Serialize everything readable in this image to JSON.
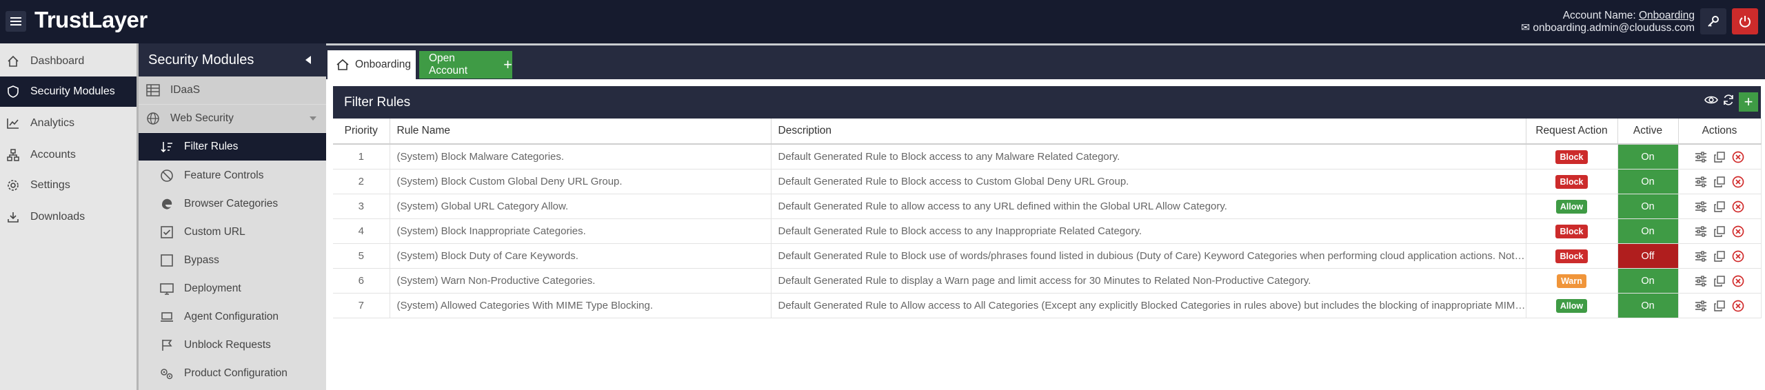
{
  "app": {
    "logo": "TrustLayer",
    "account_label": "Account Name:",
    "account_name": "Onboarding",
    "account_email": "onboarding.admin@clouduss.com"
  },
  "nav": {
    "items": [
      {
        "label": "Dashboard",
        "icon": "home-icon",
        "active": false
      },
      {
        "label": "Security Modules",
        "icon": "shield-icon",
        "active": true
      },
      {
        "label": "Analytics",
        "icon": "chart-icon",
        "active": false
      },
      {
        "label": "Accounts",
        "icon": "org-icon",
        "active": false
      },
      {
        "label": "Settings",
        "icon": "gear-icon",
        "active": false
      },
      {
        "label": "Downloads",
        "icon": "download-icon",
        "active": false
      }
    ]
  },
  "subnav": {
    "title": "Security Modules",
    "items": [
      {
        "label": "IDaaS",
        "icon": "table-icon"
      },
      {
        "label": "Web Security",
        "icon": "globe-icon"
      },
      {
        "label": "Filter Rules",
        "icon": "sort-icon"
      },
      {
        "label": "Feature Controls",
        "icon": "ban-icon"
      },
      {
        "label": "Browser Categories",
        "icon": "edge-icon"
      },
      {
        "label": "Custom URL",
        "icon": "checkbox-icon"
      },
      {
        "label": "Bypass",
        "icon": "square-icon"
      },
      {
        "label": "Deployment",
        "icon": "monitor-icon"
      },
      {
        "label": "Agent Configuration",
        "icon": "laptop-icon"
      },
      {
        "label": "Unblock Requests",
        "icon": "flag-icon"
      },
      {
        "label": "Product Configuration",
        "icon": "gears-icon"
      }
    ]
  },
  "tabs": {
    "onboarding": "Onboarding",
    "open_account": "Open Account"
  },
  "panel": {
    "title": "Filter Rules"
  },
  "table": {
    "headers": {
      "priority": "Priority",
      "rule_name": "Rule Name",
      "description": "Description",
      "request_action": "Request Action",
      "active": "Active",
      "actions": "Actions"
    },
    "rows": [
      {
        "priority": "1",
        "name": "(System) Block Malware Categories.",
        "description": "Default Generated Rule to Block access to any Malware Related Category.",
        "action": "Block",
        "action_type": "block",
        "active": "On",
        "active_state": "on"
      },
      {
        "priority": "2",
        "name": "(System) Block Custom Global Deny URL Group.",
        "description": "Default Generated Rule to Block access to Custom Global Deny URL Group.",
        "action": "Block",
        "action_type": "block",
        "active": "On",
        "active_state": "on"
      },
      {
        "priority": "3",
        "name": "(System) Global URL Category Allow.",
        "description": "Default Generated Rule to allow access to any URL defined within the Global URL Allow Category.",
        "action": "Allow",
        "action_type": "allow",
        "active": "On",
        "active_state": "on"
      },
      {
        "priority": "4",
        "name": "(System) Block Inappropriate Categories.",
        "description": "Default Generated Rule to Block access to any Inappropriate Related Category.",
        "action": "Block",
        "action_type": "block",
        "active": "On",
        "active_state": "on"
      },
      {
        "priority": "5",
        "name": "(System) Block Duty of Care Keywords.",
        "description": "Default Generated Rule to Block use of words/phrases found listed in dubious (Duty of Care) Keyword Categories when performing cloud application actions. Note: Req...",
        "action": "Block",
        "action_type": "block",
        "active": "Off",
        "active_state": "off"
      },
      {
        "priority": "6",
        "name": "(System) Warn Non-Productive Categories.",
        "description": "Default Generated Rule to display a Warn page and limit access for 30 Minutes to Related Non-Productive Category.",
        "action": "Warn",
        "action_type": "warn",
        "active": "On",
        "active_state": "on"
      },
      {
        "priority": "7",
        "name": "(System) Allowed Categories With MIME Type Blocking.",
        "description": "Default Generated Rule to Allow access to All Categories (Except any explicitly Blocked Categories in rules above) but includes the blocking of inappropriate MIME types...",
        "action": "Allow",
        "action_type": "allow",
        "active": "On",
        "active_state": "on"
      }
    ]
  },
  "colors": {
    "topbar": "#161b2e",
    "green": "#3f9b45",
    "red": "#cc2b2b",
    "orange": "#f0953a",
    "dark_red": "#b01e1e"
  }
}
